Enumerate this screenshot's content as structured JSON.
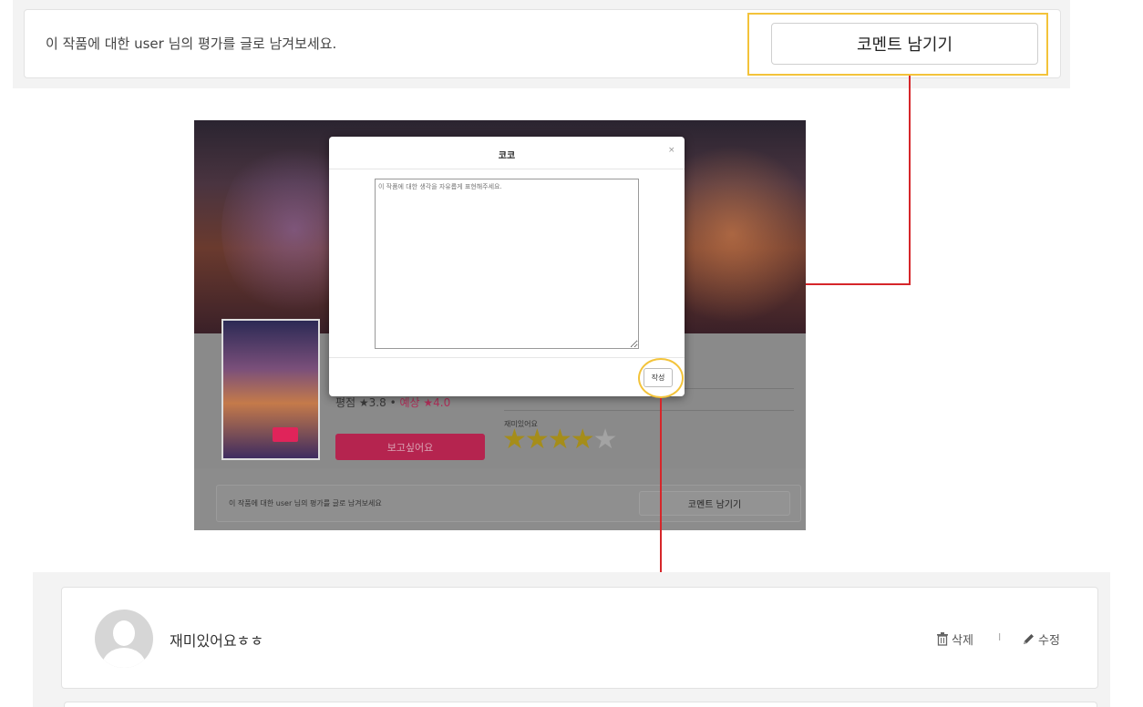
{
  "top_bar": {
    "prompt": "이 작품에 대한 user 님의 평가를 글로 남겨보세요.",
    "comment_button": "코멘트 남기기"
  },
  "screenshot": {
    "rating_prefix": "평점 ★3.8",
    "rating_separator": "•",
    "predicted": "예상 ★4.0",
    "wish_button": "보고싶어요",
    "my_review_label": "재미있어요",
    "my_rating": 4,
    "max_rating": 5,
    "prompt": "이 작품에 대한 user 님의 평가를 글로 남겨보세요",
    "comment_button": "코멘트 남기기"
  },
  "modal": {
    "title": "코코",
    "close": "×",
    "placeholder": "이 작품에 대한 생각을 자유롭게 표현해주세요.",
    "submit": "작성"
  },
  "posted_comment": {
    "text": "재미있어요ㅎㅎ",
    "delete": "삭제",
    "separator": "I",
    "edit": "수정"
  },
  "colors": {
    "highlight": "#f3c33a",
    "arrow": "#d6262a",
    "wish_button": "#b5244f"
  }
}
